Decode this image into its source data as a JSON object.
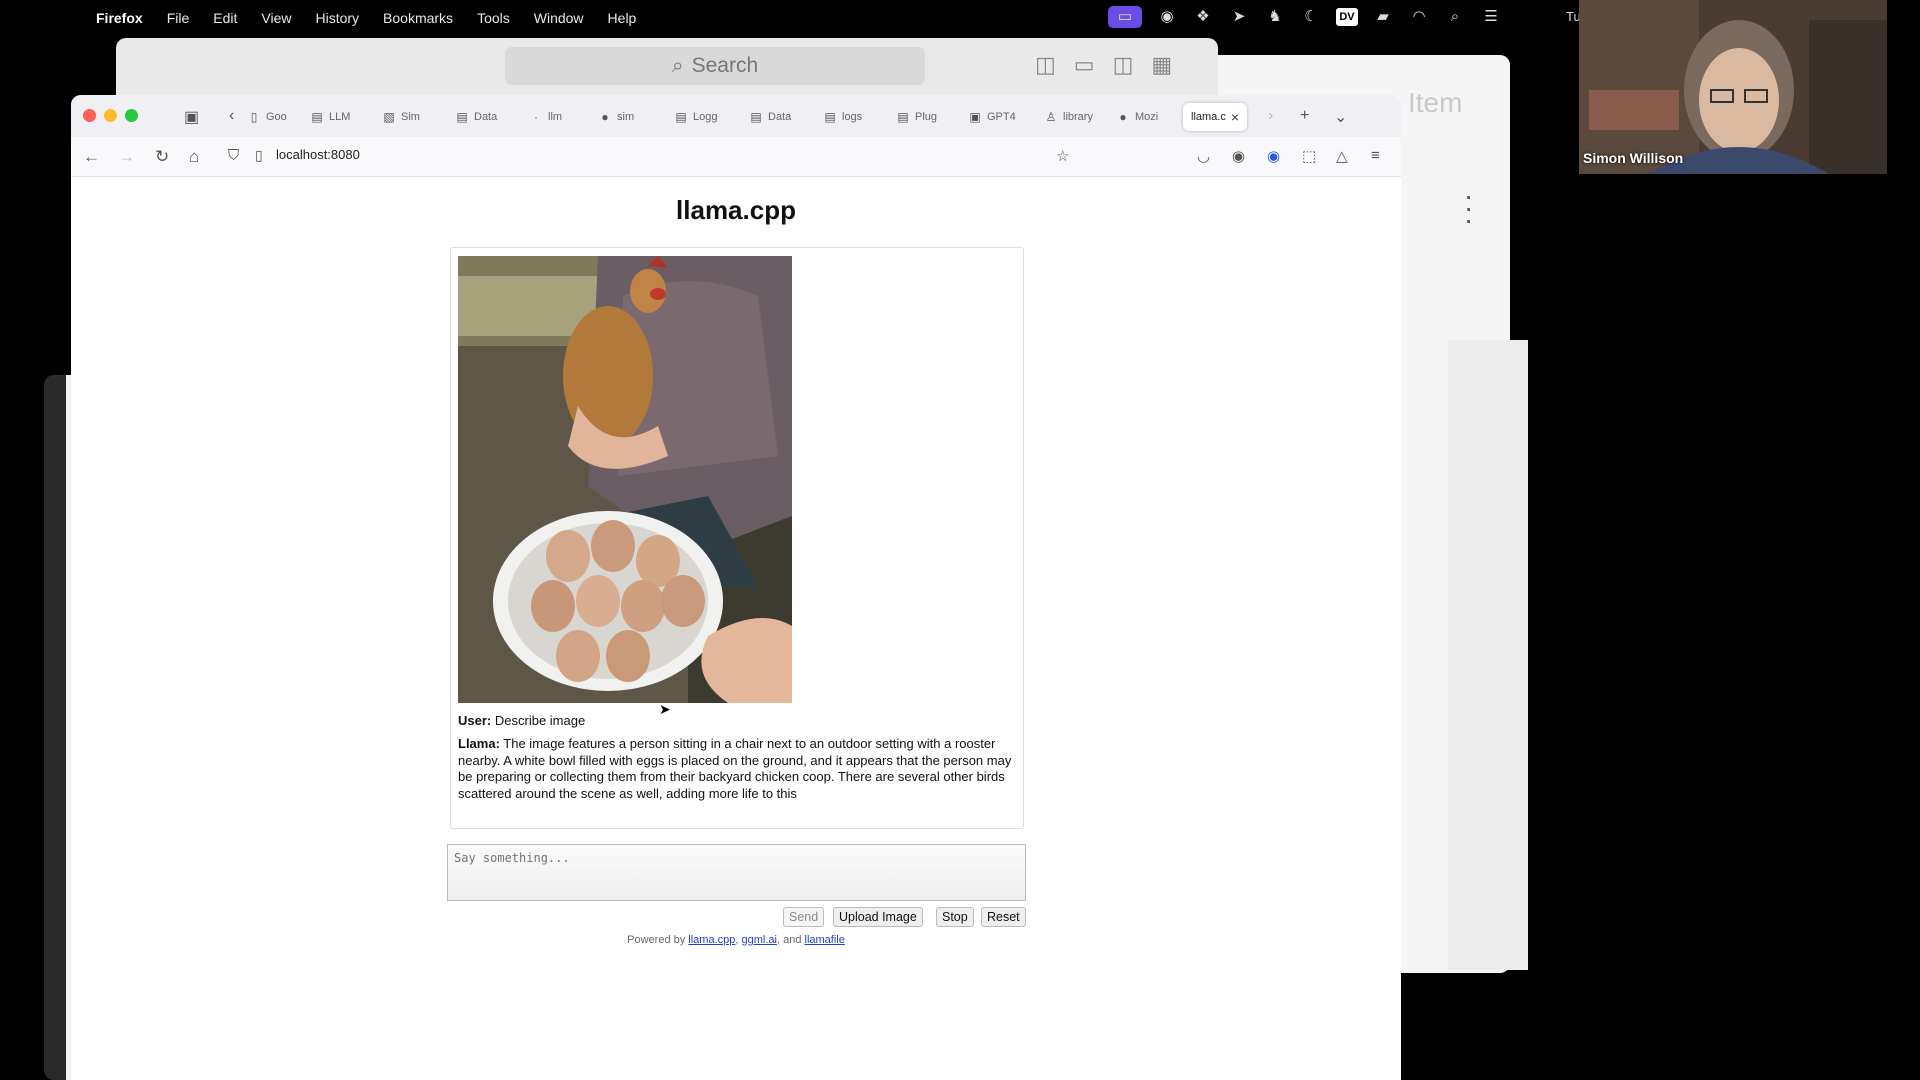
{
  "menubar": {
    "apple_icon": "apple-logo-icon",
    "app_name": "Firefox",
    "items": [
      "File",
      "Edit",
      "View",
      "History",
      "Bookmarks",
      "Tools",
      "Window",
      "Help"
    ],
    "clock_partial": "Tu"
  },
  "back_window": {
    "search_label": "Search",
    "item_label": "Item"
  },
  "browser": {
    "tabs": [
      {
        "label": "Goo",
        "icon": "document-icon"
      },
      {
        "label": "LLM",
        "icon": "document-icon"
      },
      {
        "label": "Sim",
        "icon": "image-icon"
      },
      {
        "label": "Data",
        "icon": "table-icon"
      },
      {
        "label": "llm",
        "icon": "document-icon"
      },
      {
        "label": "sim",
        "icon": "github-icon"
      },
      {
        "label": "Logg",
        "icon": "document-icon"
      },
      {
        "label": "Data",
        "icon": "table-icon"
      },
      {
        "label": "logs",
        "icon": "table-icon"
      },
      {
        "label": "Plug",
        "icon": "document-icon"
      },
      {
        "label": "GPT4",
        "icon": "document-icon"
      },
      {
        "label": "library",
        "icon": "person-icon"
      },
      {
        "label": "Mozi",
        "icon": "github-icon"
      }
    ],
    "active_tab": {
      "label": "llama.c",
      "close": "×"
    },
    "url": "localhost:8080"
  },
  "page": {
    "title": "llama.cpp",
    "user_label": "User:",
    "user_message": "Describe image",
    "llama_label": "Llama:",
    "llama_message": "The image features a person sitting in a chair next to an outdoor setting with a rooster nearby. A white bowl filled with eggs is placed on the ground, and it appears that the person may be preparing or collecting them from their backyard chicken coop. There are several other birds scattered around the scene as well, adding more life to this",
    "input_placeholder": "Say something...",
    "buttons": {
      "send": "Send",
      "upload": "Upload Image",
      "stop": "Stop",
      "reset": "Reset"
    },
    "powered_prefix": "Powered by ",
    "powered_link1": "llama.cpp",
    "powered_sep1": ", ",
    "powered_link2": "ggml.ai",
    "powered_sep2": ", and ",
    "powered_link3": "llamafile"
  },
  "webcam": {
    "name": "Simon Willison"
  }
}
